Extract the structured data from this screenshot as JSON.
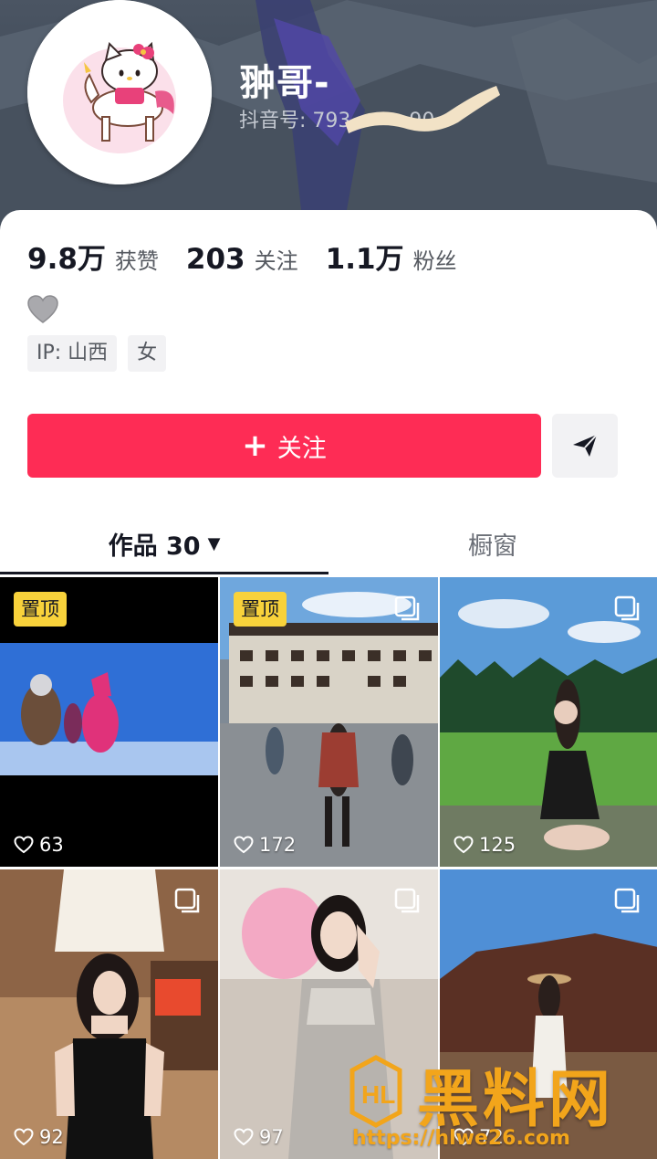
{
  "profile": {
    "nickname": "翀哥-",
    "douyin_id_label": "抖音号: 793",
    "id_suffix": "90"
  },
  "stats": [
    {
      "value": "9.8万",
      "label": "获赞"
    },
    {
      "value": "203",
      "label": "关注"
    },
    {
      "value": "1.1万",
      "label": "粉丝"
    }
  ],
  "bio_emoji": "🩶",
  "tags": [
    "IP: 山西",
    "女"
  ],
  "actions": {
    "follow_label": "关注",
    "follow_plus": "+",
    "share_icon": "paper-plane-icon"
  },
  "tabs": {
    "works_label": "作品 30",
    "shop_label": "橱窗"
  },
  "posts": [
    {
      "likes": "63",
      "pinned": true,
      "pin_label": "置顶",
      "multi": false
    },
    {
      "likes": "172",
      "pinned": true,
      "pin_label": "置顶",
      "multi": true
    },
    {
      "likes": "125",
      "pinned": false,
      "multi": true
    },
    {
      "likes": "92",
      "pinned": false,
      "multi": true
    },
    {
      "likes": "97",
      "pinned": false,
      "multi": true
    },
    {
      "likes": "72",
      "pinned": false,
      "multi": true
    }
  ],
  "watermark": {
    "brand": "黑料网",
    "url": "https://hlwe26.com"
  },
  "colors": {
    "follow_button": "#fe2c55",
    "pin_badge": "#f8d23b",
    "watermark": "#f2a51b"
  }
}
